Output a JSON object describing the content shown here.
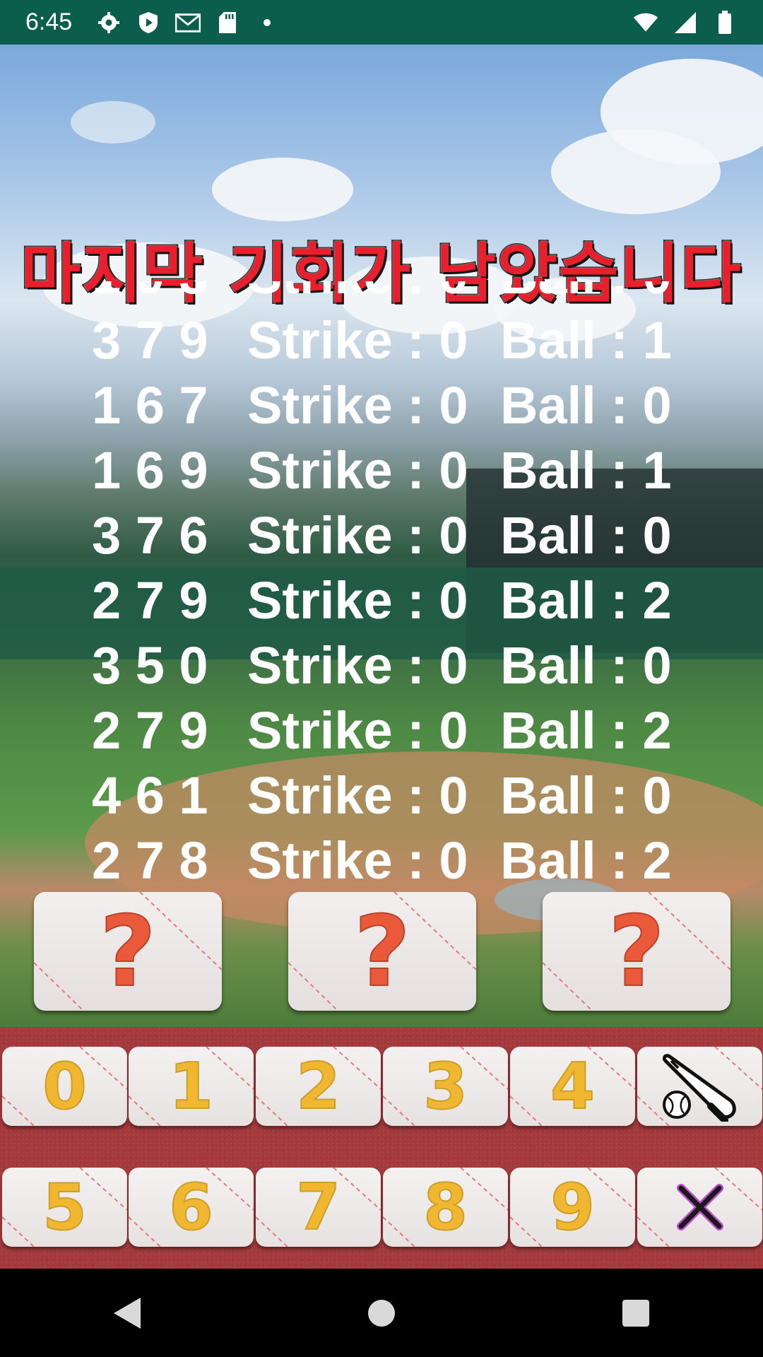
{
  "status_bar": {
    "time": "6:45",
    "icons_left": [
      "gear-icon",
      "shield-play-icon",
      "mail-icon",
      "sd-card-icon",
      "dot-icon"
    ],
    "icons_right": [
      "wifi-icon",
      "signal-icon",
      "battery-icon"
    ]
  },
  "game": {
    "banner": "마지막 기회가 남았습니다",
    "history": [
      {
        "nums": "1 0 3",
        "strike": "Strike : 0",
        "ball": "Ball : 0"
      },
      {
        "nums": "3 7 9",
        "strike": "Strike : 0",
        "ball": "Ball : 1"
      },
      {
        "nums": "1 6 7",
        "strike": "Strike : 0",
        "ball": "Ball : 0"
      },
      {
        "nums": "1 6 9",
        "strike": "Strike : 0",
        "ball": "Ball : 1"
      },
      {
        "nums": "3 7 6",
        "strike": "Strike : 0",
        "ball": "Ball : 0"
      },
      {
        "nums": "2 7 9",
        "strike": "Strike : 0",
        "ball": "Ball : 2"
      },
      {
        "nums": "3 5 0",
        "strike": "Strike : 0",
        "ball": "Ball : 0"
      },
      {
        "nums": "2 7 9",
        "strike": "Strike : 0",
        "ball": "Ball : 2"
      },
      {
        "nums": "4 6 1",
        "strike": "Strike : 0",
        "ball": "Ball : 0"
      },
      {
        "nums": "2 7 8",
        "strike": "Strike : 0",
        "ball": "Ball : 2"
      }
    ],
    "guess_slots": [
      "?",
      "?",
      "?"
    ]
  },
  "keypad": {
    "row1": [
      "0",
      "1",
      "2",
      "3",
      "4"
    ],
    "row2": [
      "5",
      "6",
      "7",
      "8",
      "9"
    ],
    "submit_icon": "bat-and-ball-icon",
    "delete_icon": "close-icon"
  },
  "nav": {
    "icons": [
      "back-icon",
      "home-icon",
      "recents-icon"
    ]
  },
  "colors": {
    "status_bar": "#0b5e4b",
    "banner_text": "#e8202e",
    "digit": "#f2b731",
    "question_mark": "#ea5a3a",
    "keypad_bg": "#a43a3c"
  }
}
